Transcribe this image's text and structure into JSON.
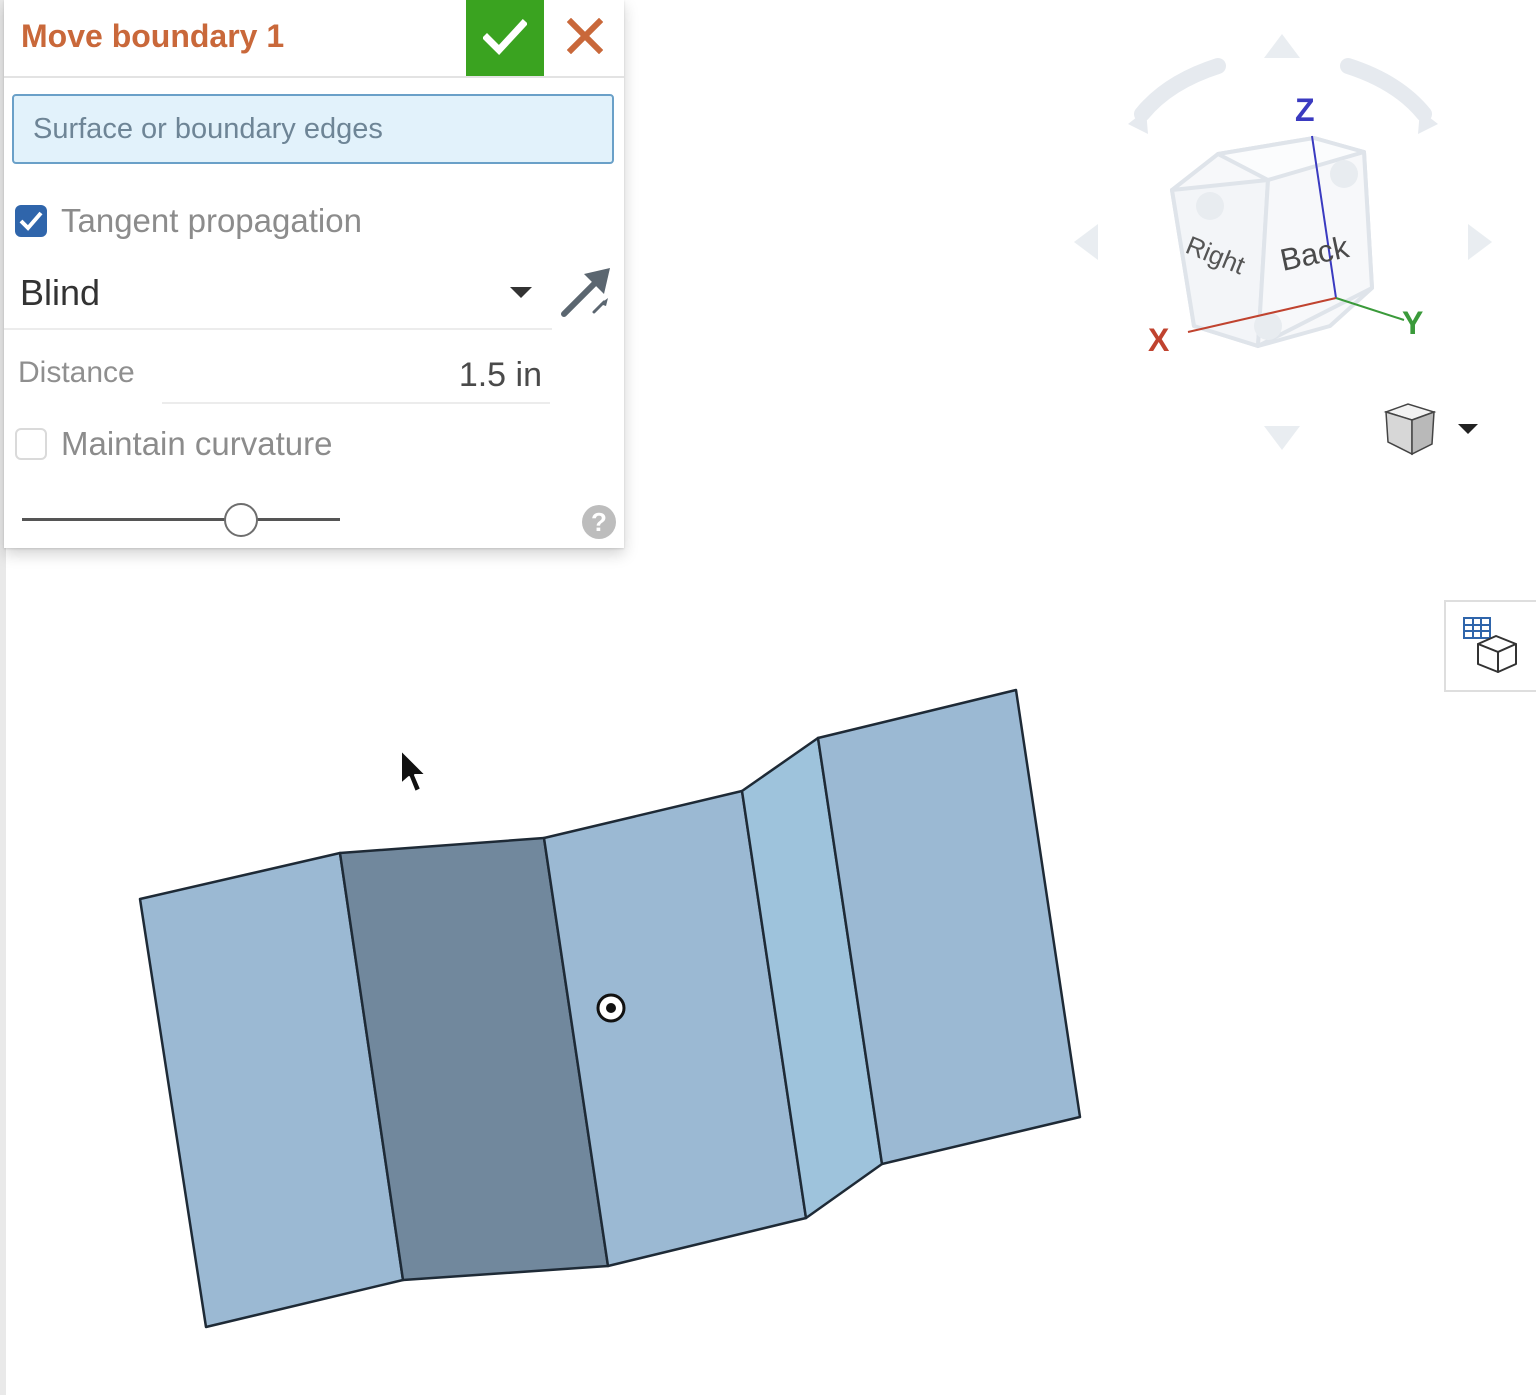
{
  "dialog": {
    "title": "Move boundary 1",
    "accept_icon": "check-icon",
    "cancel_icon": "close-icon",
    "selection_placeholder": "Surface or boundary edges",
    "tangent_propagation": {
      "label": "Tangent propagation",
      "checked": true
    },
    "end_type": {
      "value": "Blind",
      "flip_icon": "flip-direction-icon"
    },
    "distance": {
      "label": "Distance",
      "value": "1.5 in"
    },
    "maintain_curvature": {
      "label": "Maintain curvature",
      "checked": false
    },
    "rollback_slider": {
      "position_fraction": 0.69
    },
    "help_icon": "help-icon"
  },
  "view_cube": {
    "faces": {
      "right": "Right",
      "back": "Back"
    },
    "axes": {
      "x": "X",
      "y": "Y",
      "z": "Z"
    },
    "view_mode_icon": "shaded-cube-icon",
    "named_views_icon": "named-views-icon"
  },
  "colors": {
    "title": "#c9683a",
    "accept": "#3aa320",
    "cancel": "#c9683a",
    "selection_bg": "#e2f2fb",
    "checkbox_checked": "#2f65ab",
    "surface_face": "#9bb9d3",
    "surface_face_selected": "#71889d",
    "surface_face_light": "#9ec3dc",
    "axis_x": "#c0432f",
    "axis_y": "#3a9a3a",
    "axis_z": "#3a3ac0"
  }
}
